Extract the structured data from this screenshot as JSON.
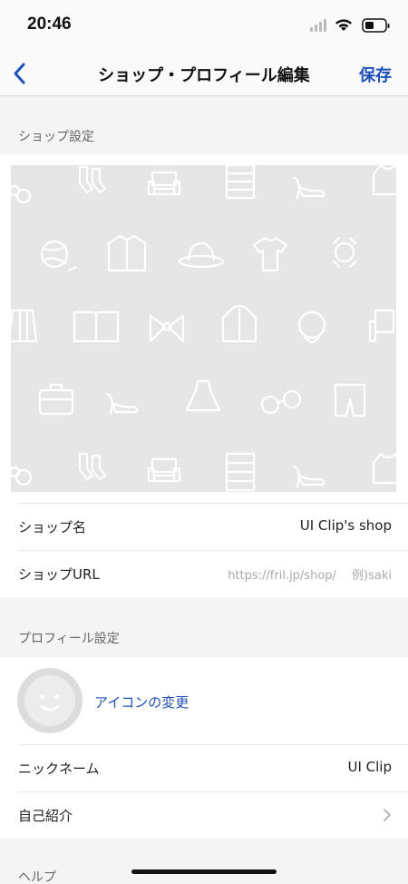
{
  "status_bar": {
    "time": "20:46"
  },
  "nav": {
    "back_icon": "chevron-left-icon",
    "title": "ショップ・プロフィール編集",
    "save_label": "保存"
  },
  "sections": {
    "shop_settings": "ショップ設定",
    "profile_settings": "プロフィール設定",
    "help": "ヘルプ"
  },
  "cover": {
    "icons": [
      "bag-icon",
      "socks-icon",
      "armchair-icon",
      "drawer-icon",
      "heel-icon",
      "hoodie-icon",
      "yarn-icon",
      "shirt-icon",
      "hat-icon",
      "tshirt-icon",
      "watch-icon",
      "skirt-icon",
      "book-icon",
      "bow-icon",
      "jacket-icon",
      "necklace-icon",
      "chair-icon",
      "briefcase-icon",
      "heel-icon",
      "dress-icon",
      "glasses-icon",
      "shorts-icon",
      "bag-icon",
      "socks-icon",
      "armchair-icon",
      "drawer-icon",
      "heel-icon",
      "hoodie-icon"
    ]
  },
  "shop": {
    "name_label": "ショップ名",
    "name_value": "UI Clip's shop",
    "url_label": "ショップURL",
    "url_placeholder": "https://fril.jp/shop/　 例)saki"
  },
  "profile": {
    "avatar_icon": "smiley-avatar-icon",
    "change_icon_label": "アイコンの変更",
    "nickname_label": "ニックネーム",
    "nickname_value": "UI Clip",
    "intro_label": "自己紹介",
    "intro_chevron": "chevron-right-icon"
  },
  "colors": {
    "accent": "#1f4fb8",
    "cover_bg": "#e6e6e6",
    "page_bg": "#f4f4f4"
  }
}
